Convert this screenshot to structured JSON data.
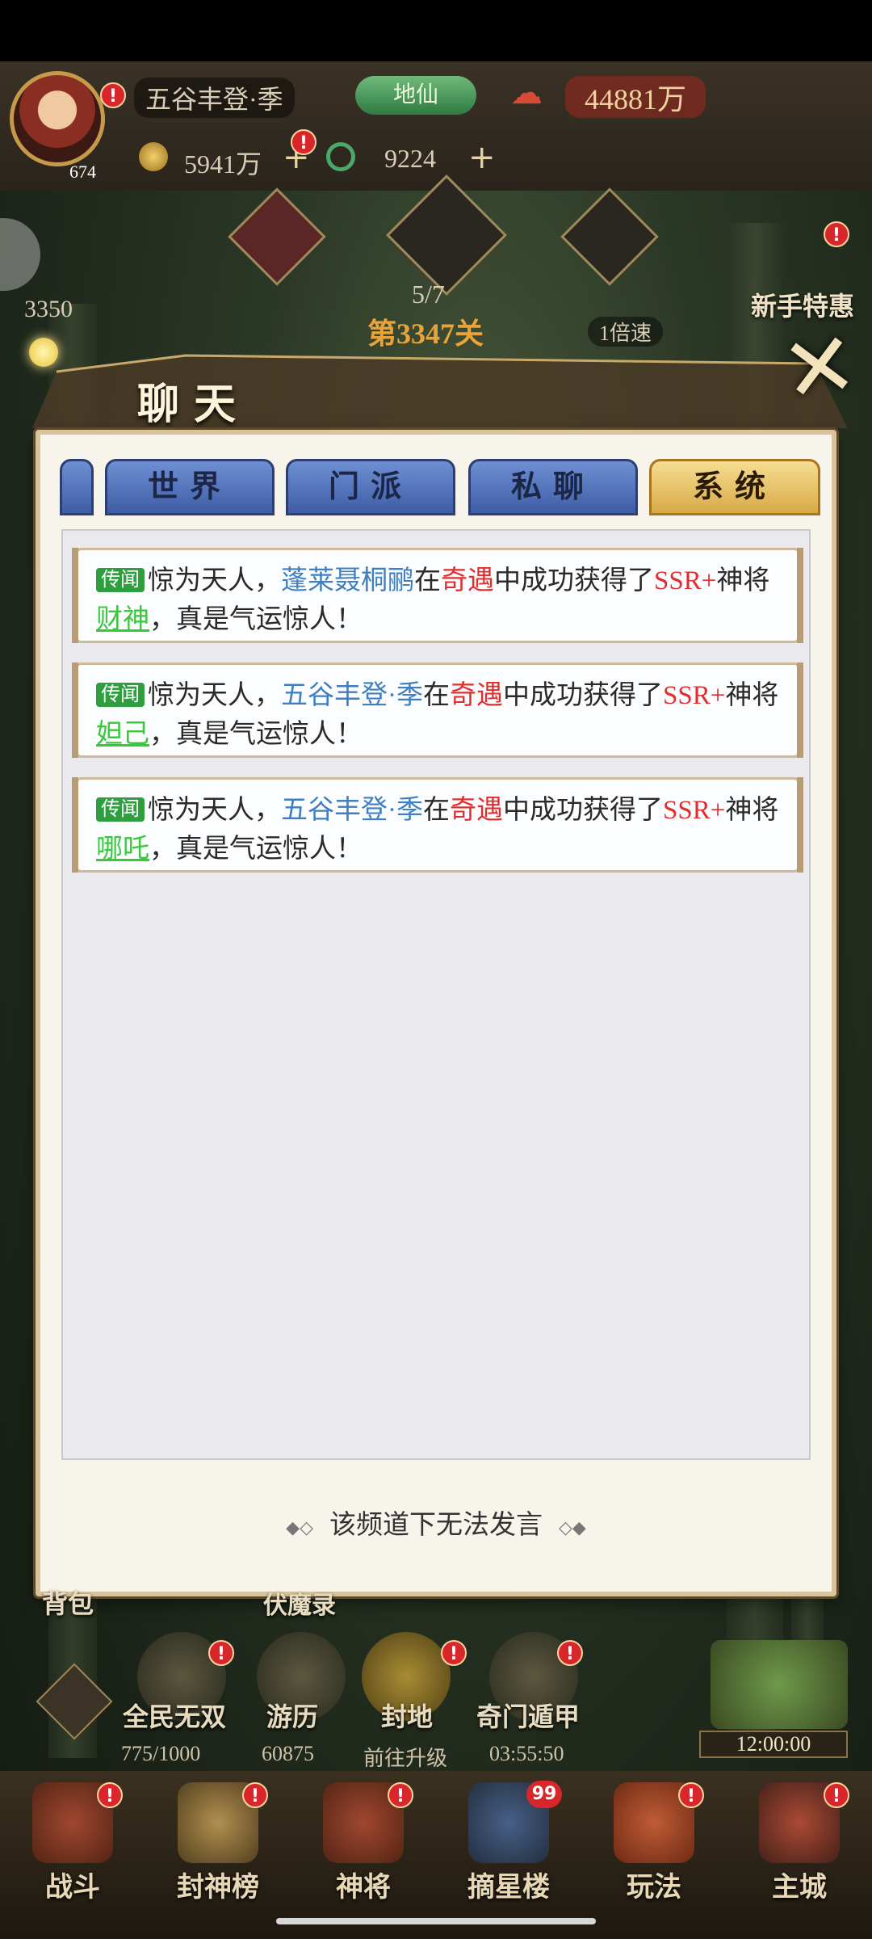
{
  "hud": {
    "player_name": "五谷丰登·季",
    "title_badge": "地仙",
    "power": "44881万",
    "level": "674",
    "gold": "5941万",
    "jade": "9224",
    "stage_progress": "5/7",
    "stage_name": "第3347关",
    "speed": "1倍速",
    "left_counter": "3350",
    "newbie_offer": "新手特惠"
  },
  "chat": {
    "title": "聊天",
    "tabs": [
      {
        "label": "世界"
      },
      {
        "label": "门派"
      },
      {
        "label": "私聊"
      },
      {
        "label": "系统"
      }
    ],
    "active_tab": "系统",
    "messages": [
      {
        "tag": "传闻",
        "t1": "惊为天人，",
        "player": "蓬莱聂桐鹂",
        "t2": "在",
        "event": "奇遇",
        "t3": "中成功获得了",
        "rarity": "SSR+",
        "t4": "神将",
        "hero": "财神",
        "t5": "，真是气运惊人！"
      },
      {
        "tag": "传闻",
        "t1": "惊为天人，",
        "player": "五谷丰登·季",
        "t2": "在",
        "event": "奇遇",
        "t3": "中成功获得了",
        "rarity": "SSR+",
        "t4": "神将",
        "hero": "妲己",
        "t5": "，真是气运惊人！"
      },
      {
        "tag": "传闻",
        "t1": "惊为天人，",
        "player": "五谷丰登·季",
        "t2": "在",
        "event": "奇遇",
        "t3": "中成功获得了",
        "rarity": "SSR+",
        "t4": "神将",
        "hero": "哪吒",
        "t5": "，真是气运惊人！"
      }
    ],
    "footer_note": "该频道下无法发言"
  },
  "activities": [
    {
      "label": "全民无双",
      "sub": "775/1000"
    },
    {
      "label": "游历",
      "sub": "60875"
    },
    {
      "label": "封地",
      "sub": "前往升级"
    },
    {
      "label": "奇门遁甲",
      "sub": "03:55:50"
    }
  ],
  "left_buttons": {
    "bag": "背包",
    "subdue": "伏魔录"
  },
  "chest_timer": "12:00:00",
  "nav": [
    {
      "label": "战斗"
    },
    {
      "label": "封神榜"
    },
    {
      "label": "神将"
    },
    {
      "label": "摘星楼",
      "badge": "99"
    },
    {
      "label": "玩法"
    },
    {
      "label": "主城"
    }
  ],
  "colors": {
    "player_name": "#3e7fc3",
    "highlight_red": "#e12d2d",
    "hero_green": "#38c93b",
    "tag_green": "#2f9e3f",
    "active_tab": "#e8c366",
    "inactive_tab": "#5275c0"
  }
}
